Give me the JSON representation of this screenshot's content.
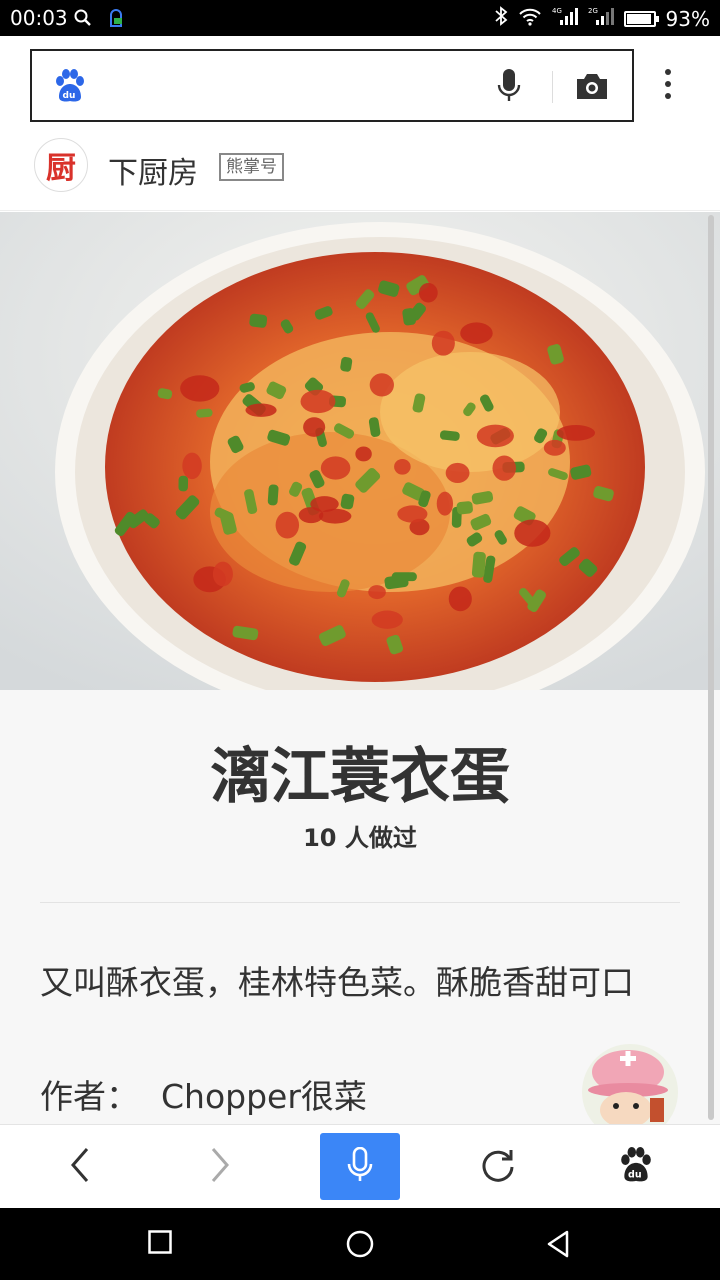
{
  "status_bar": {
    "time": "00:03",
    "battery_percent": "93%",
    "battery_level": 0.93,
    "left_icons": [
      "search-icon",
      "app-notification-icon"
    ],
    "right_icons": [
      "bluetooth-icon",
      "wifi-icon",
      "4g-signal-icon",
      "2g-signal-icon",
      "battery-icon"
    ],
    "signal_labels": {
      "first": "4G",
      "second": "2G"
    }
  },
  "search": {
    "placeholder": "",
    "icons": [
      "baidu-paw-icon",
      "microphone-icon",
      "camera-icon",
      "more-vertical-icon"
    ]
  },
  "source": {
    "logo_char": "厨",
    "name": "下厨房",
    "badge": "熊掌号"
  },
  "recipe": {
    "title": "漓江蓑衣蛋",
    "made_count": "10 人做过",
    "description": "又叫酥衣蛋，桂林特色菜。酥脆香甜可口",
    "author_label": "作者：",
    "author_name": "Chopper很菜"
  },
  "bottom_nav": {
    "items": [
      "back-icon",
      "forward-icon",
      "voice-search-icon",
      "refresh-icon",
      "baidu-home-icon"
    ]
  },
  "system_nav": {
    "items": [
      "recent-apps-icon",
      "home-icon",
      "back-triangle-icon"
    ]
  },
  "colors": {
    "accent_blue": "#3b86f7",
    "baidu_blue": "#2c67e8",
    "source_red": "#d9322b"
  }
}
